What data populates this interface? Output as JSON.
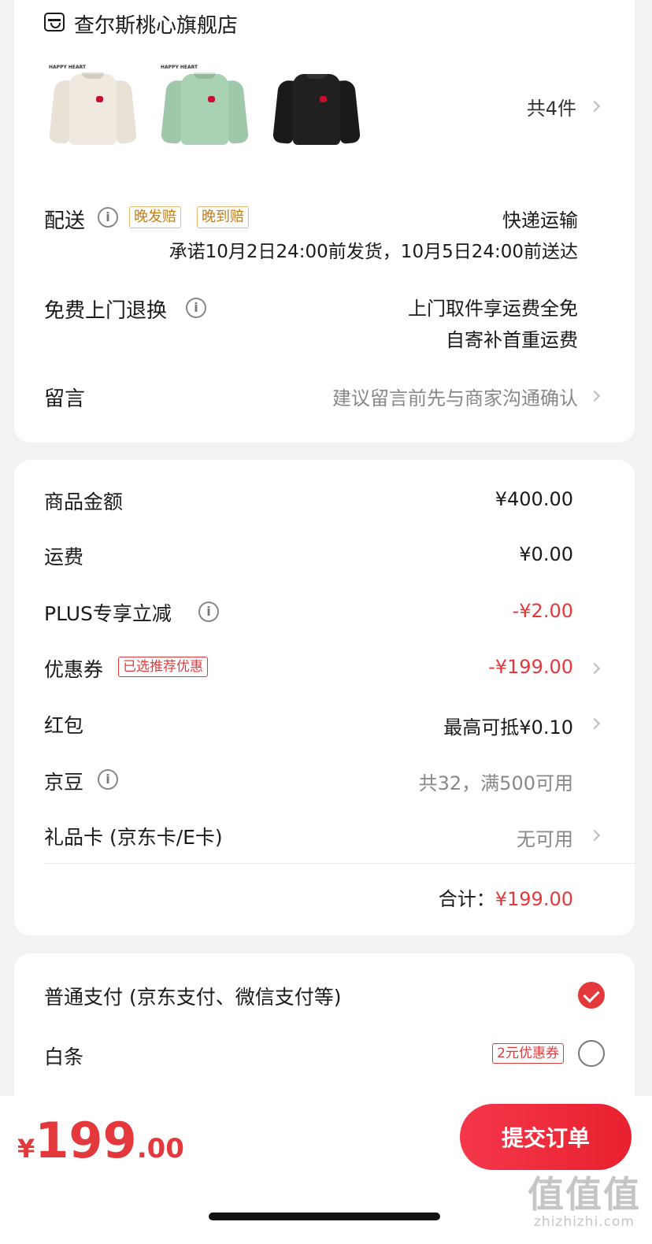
{
  "store": {
    "name": "查尔斯桃心旗舰店",
    "products": [
      {
        "color": "#efe9df",
        "tag": "HAPPY HEART"
      },
      {
        "color": "#a9d1b4",
        "tag": "HAPPY HEART"
      },
      {
        "color": "#202020",
        "tag": ""
      }
    ],
    "count_text": "共4件"
  },
  "delivery": {
    "label": "配送",
    "tags": [
      "晚发赔",
      "晚到赔"
    ],
    "method": "快递运输",
    "promise": "承诺10月2日24:00前发货，10月5日24:00前送达"
  },
  "returns": {
    "label": "免费上门退换",
    "line1": "上门取件享运费全免",
    "line2": "自寄补首重运费"
  },
  "message": {
    "label": "留言",
    "placeholder": "建议留言前先与商家沟通确认"
  },
  "price": {
    "goods_label": "商品金额",
    "goods_value": "¥400.00",
    "shipping_label": "运费",
    "shipping_value": "¥0.00",
    "plus_label": "PLUS专享立减",
    "plus_value": "-¥2.00",
    "coupon_label": "优惠券",
    "coupon_tag": "已选推荐优惠",
    "coupon_value": "-¥199.00",
    "redpacket_label": "红包",
    "redpacket_value": "最高可抵¥0.10",
    "jingdou_label": "京豆",
    "jingdou_value": "共32，满500可用",
    "giftcard_label": "礼品卡 (京东卡/E卡)",
    "giftcard_value": "无可用",
    "total_label": "合计：",
    "total_value": "¥199.00"
  },
  "payment": {
    "normal_label": "普通支付 (京东支付、微信支付等)",
    "normal_selected": true,
    "baitiao_label": "白条",
    "baitiao_tag": "2元优惠券",
    "baitiao_selected": false
  },
  "bottom": {
    "currency": "¥",
    "total_int": "199",
    "total_dec": ".00",
    "submit_label": "提交订单"
  },
  "watermark": {
    "big": "值值值",
    "small": "zhizhizhi.com"
  },
  "colors": {
    "accent_red": "#e4393c",
    "tag_gold": "#c47d10",
    "background": "#f2f2f2"
  },
  "icons": [
    "store-icon",
    "info-icon",
    "chevron-right-icon",
    "check-circle-icon",
    "radio-empty-icon"
  ]
}
